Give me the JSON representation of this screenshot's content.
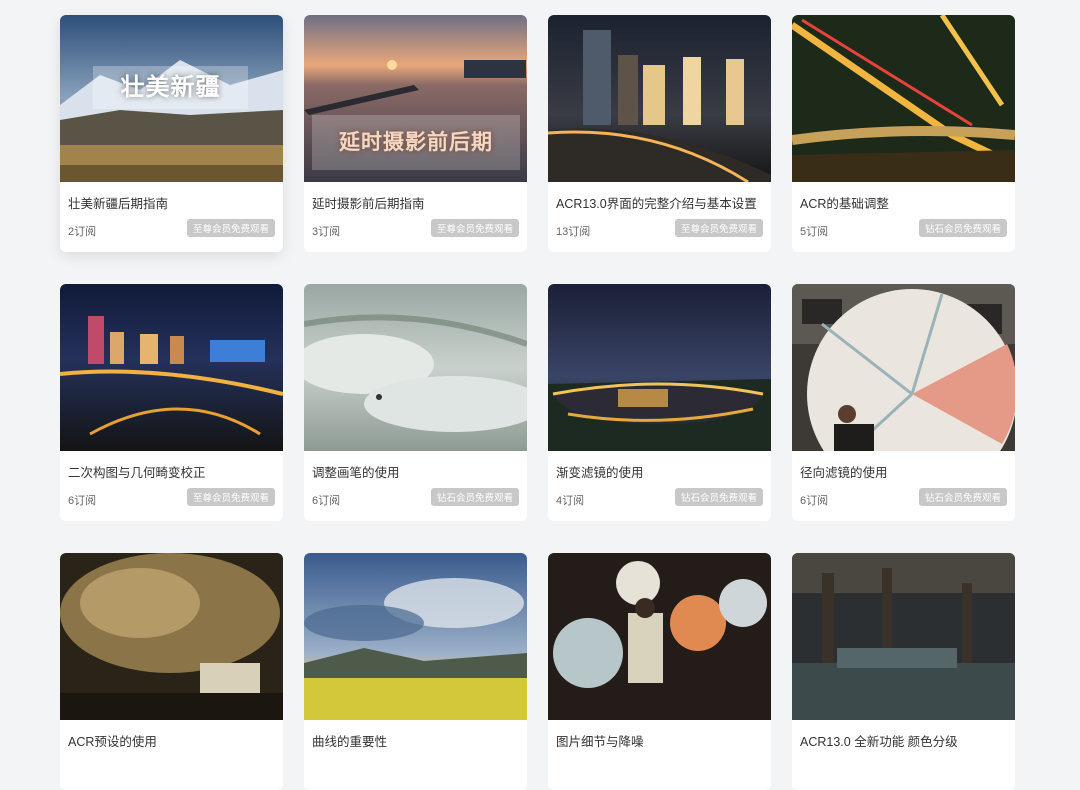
{
  "courses": [
    {
      "title": "壮美新疆后期指南",
      "subs": "2订阅",
      "badge": "至尊会员免费观看",
      "overlay": "壮美新疆",
      "raised": true
    },
    {
      "title": "延时摄影前后期指南",
      "subs": "3订阅",
      "badge": "至尊会员免费观看",
      "overlay": "延时摄影前后期"
    },
    {
      "title": "ACR13.0界面的完整介绍与基本设置",
      "subs": "13订阅",
      "badge": "至尊会员免费观看"
    },
    {
      "title": "ACR的基础调整",
      "subs": "5订阅",
      "badge": "钻石会员免费观看"
    },
    {
      "title": "二次构图与几何畸变校正",
      "subs": "6订阅",
      "badge": "至尊会员免费观看"
    },
    {
      "title": "调整画笔的使用",
      "subs": "6订阅",
      "badge": "钻石会员免费观看"
    },
    {
      "title": "渐变滤镜的使用",
      "subs": "4订阅",
      "badge": "钻石会员免费观看"
    },
    {
      "title": "径向滤镜的使用",
      "subs": "6订阅",
      "badge": "钻石会员免费观看"
    },
    {
      "title": "ACR预设的使用",
      "subs": "",
      "badge": ""
    },
    {
      "title": "曲线的重要性",
      "subs": "",
      "badge": ""
    },
    {
      "title": "图片细节与降噪",
      "subs": "",
      "badge": ""
    },
    {
      "title": "ACR13.0 全新功能 颜色分级",
      "subs": "",
      "badge": ""
    }
  ]
}
